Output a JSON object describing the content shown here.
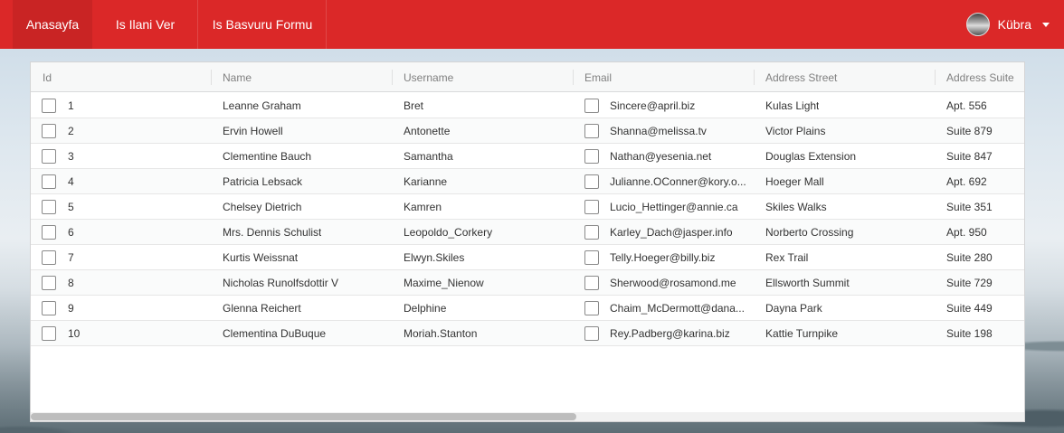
{
  "nav": {
    "items": [
      {
        "label": "Anasayfa",
        "active": true
      },
      {
        "label": "Is Ilani Ver",
        "active": false
      },
      {
        "label": "Is Basvuru Formu",
        "active": false
      }
    ],
    "user_name": "Kübra",
    "accent_color": "#db2828"
  },
  "table": {
    "columns": [
      "Id",
      "Name",
      "Username",
      "Email",
      "Address Street",
      "Address Suite"
    ],
    "rows": [
      {
        "id": "1",
        "name": "Leanne Graham",
        "username": "Bret",
        "email": "Sincere@april.biz",
        "street": "Kulas Light",
        "suite": "Apt. 556"
      },
      {
        "id": "2",
        "name": "Ervin Howell",
        "username": "Antonette",
        "email": "Shanna@melissa.tv",
        "street": "Victor Plains",
        "suite": "Suite 879"
      },
      {
        "id": "3",
        "name": "Clementine Bauch",
        "username": "Samantha",
        "email": "Nathan@yesenia.net",
        "street": "Douglas Extension",
        "suite": "Suite 847"
      },
      {
        "id": "4",
        "name": "Patricia Lebsack",
        "username": "Karianne",
        "email": "Julianne.OConner@kory.o...",
        "street": "Hoeger Mall",
        "suite": "Apt. 692"
      },
      {
        "id": "5",
        "name": "Chelsey Dietrich",
        "username": "Kamren",
        "email": "Lucio_Hettinger@annie.ca",
        "street": "Skiles Walks",
        "suite": "Suite 351"
      },
      {
        "id": "6",
        "name": "Mrs. Dennis Schulist",
        "username": "Leopoldo_Corkery",
        "email": "Karley_Dach@jasper.info",
        "street": "Norberto Crossing",
        "suite": "Apt. 950"
      },
      {
        "id": "7",
        "name": "Kurtis Weissnat",
        "username": "Elwyn.Skiles",
        "email": "Telly.Hoeger@billy.biz",
        "street": "Rex Trail",
        "suite": "Suite 280"
      },
      {
        "id": "8",
        "name": "Nicholas Runolfsdottir V",
        "username": "Maxime_Nienow",
        "email": "Sherwood@rosamond.me",
        "street": "Ellsworth Summit",
        "suite": "Suite 729"
      },
      {
        "id": "9",
        "name": "Glenna Reichert",
        "username": "Delphine",
        "email": "Chaim_McDermott@dana...",
        "street": "Dayna Park",
        "suite": "Suite 449"
      },
      {
        "id": "10",
        "name": "Clementina DuBuque",
        "username": "Moriah.Stanton",
        "email": "Rey.Padberg@karina.biz",
        "street": "Kattie Turnpike",
        "suite": "Suite 198"
      }
    ]
  }
}
